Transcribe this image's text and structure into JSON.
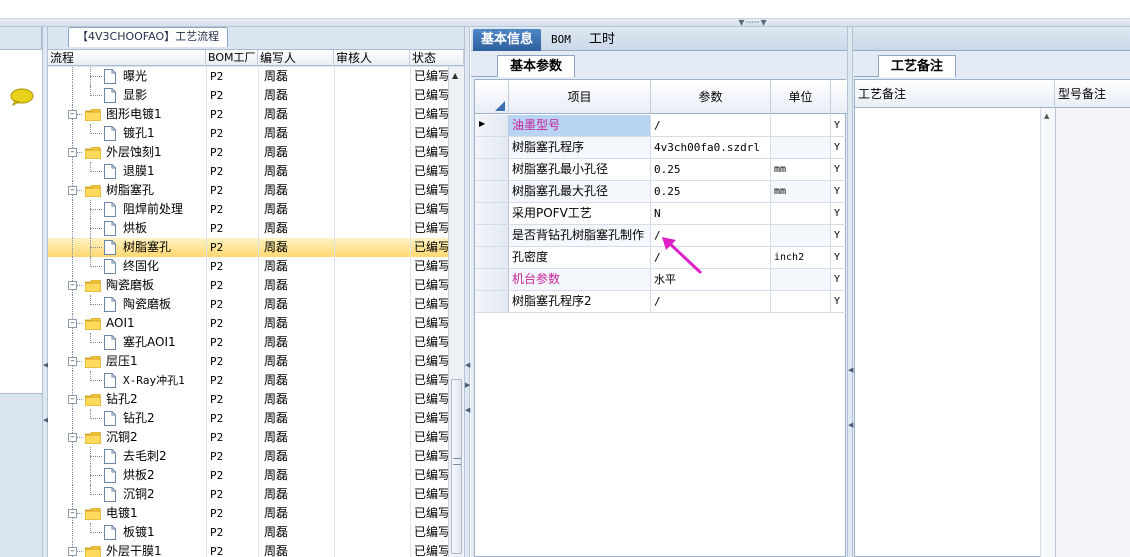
{
  "tree": {
    "title": "【4V3CHOOFAO】工艺流程",
    "columns": [
      "流程",
      "BOM工厂",
      "编写人",
      "审核人",
      "状态"
    ],
    "rows": [
      {
        "level": 2,
        "type": "doc",
        "label": "曝光",
        "bom": "P2",
        "author": "周磊",
        "reviewer": "",
        "status": "已编写",
        "last": false
      },
      {
        "level": 2,
        "type": "doc",
        "label": "显影",
        "bom": "P2",
        "author": "周磊",
        "reviewer": "",
        "status": "已编写",
        "last": true
      },
      {
        "level": 1,
        "type": "folder",
        "label": "图形电镀1",
        "bom": "P2",
        "author": "周磊",
        "reviewer": "",
        "status": "已编写"
      },
      {
        "level": 2,
        "type": "doc",
        "label": "镀孔1",
        "bom": "P2",
        "author": "周磊",
        "reviewer": "",
        "status": "已编写",
        "last": true
      },
      {
        "level": 1,
        "type": "folder",
        "label": "外层蚀刻1",
        "bom": "P2",
        "author": "周磊",
        "reviewer": "",
        "status": "已编写"
      },
      {
        "level": 2,
        "type": "doc",
        "label": "退膜1",
        "bom": "P2",
        "author": "周磊",
        "reviewer": "",
        "status": "已编写",
        "last": true
      },
      {
        "level": 1,
        "type": "folder",
        "label": "树脂塞孔",
        "bom": "P2",
        "author": "周磊",
        "reviewer": "",
        "status": "已编写"
      },
      {
        "level": 2,
        "type": "doc",
        "label": "阻焊前处理",
        "bom": "P2",
        "author": "周磊",
        "reviewer": "",
        "status": "已编写",
        "last": false
      },
      {
        "level": 2,
        "type": "doc",
        "label": "烘板",
        "bom": "P2",
        "author": "周磊",
        "reviewer": "",
        "status": "已编写",
        "last": false
      },
      {
        "level": 2,
        "type": "doc",
        "label": "树脂塞孔",
        "bom": "P2",
        "author": "周磊",
        "reviewer": "",
        "status": "已编写",
        "last": false,
        "selected": true
      },
      {
        "level": 2,
        "type": "doc",
        "label": "终固化",
        "bom": "P2",
        "author": "周磊",
        "reviewer": "",
        "status": "已编写",
        "last": true
      },
      {
        "level": 1,
        "type": "folder",
        "label": "陶瓷磨板",
        "bom": "P2",
        "author": "周磊",
        "reviewer": "",
        "status": "已编写"
      },
      {
        "level": 2,
        "type": "doc",
        "label": "陶瓷磨板",
        "bom": "P2",
        "author": "周磊",
        "reviewer": "",
        "status": "已编写",
        "last": true
      },
      {
        "level": 1,
        "type": "folder",
        "label": "AOI1",
        "bom": "P2",
        "author": "周磊",
        "reviewer": "",
        "status": "已编写"
      },
      {
        "level": 2,
        "type": "doc",
        "label": "塞孔AOI1",
        "bom": "P2",
        "author": "周磊",
        "reviewer": "",
        "status": "已编写",
        "last": true
      },
      {
        "level": 1,
        "type": "folder",
        "label": "层压1",
        "bom": "P2",
        "author": "周磊",
        "reviewer": "",
        "status": "已编写"
      },
      {
        "level": 2,
        "type": "doc",
        "label": "X-Ray冲孔1",
        "bom": "P2",
        "author": "周磊",
        "reviewer": "",
        "status": "已编写",
        "last": true
      },
      {
        "level": 1,
        "type": "folder",
        "label": "钻孔2",
        "bom": "P2",
        "author": "周磊",
        "reviewer": "",
        "status": "已编写"
      },
      {
        "level": 2,
        "type": "doc",
        "label": "钻孔2",
        "bom": "P2",
        "author": "周磊",
        "reviewer": "",
        "status": "已编写",
        "last": true
      },
      {
        "level": 1,
        "type": "folder",
        "label": "沉铜2",
        "bom": "P2",
        "author": "周磊",
        "reviewer": "",
        "status": "已编写"
      },
      {
        "level": 2,
        "type": "doc",
        "label": "去毛刺2",
        "bom": "P2",
        "author": "周磊",
        "reviewer": "",
        "status": "已编写",
        "last": false
      },
      {
        "level": 2,
        "type": "doc",
        "label": "烘板2",
        "bom": "P2",
        "author": "周磊",
        "reviewer": "",
        "status": "已编写",
        "last": false
      },
      {
        "level": 2,
        "type": "doc",
        "label": "沉铜2",
        "bom": "P2",
        "author": "周磊",
        "reviewer": "",
        "status": "已编写",
        "last": true
      },
      {
        "level": 1,
        "type": "folder",
        "label": "电镀1",
        "bom": "P2",
        "author": "周磊",
        "reviewer": "",
        "status": "已编写"
      },
      {
        "level": 2,
        "type": "doc",
        "label": "板镀1",
        "bom": "P2",
        "author": "周磊",
        "reviewer": "",
        "status": "已编写",
        "last": true
      },
      {
        "level": 1,
        "type": "folder",
        "label": "外层干膜1",
        "bom": "P2",
        "author": "周磊",
        "reviewer": "",
        "status": "已编写"
      }
    ]
  },
  "main_tabs": [
    "基本信息",
    "BOM",
    "工时"
  ],
  "params": {
    "tab": "基本参数",
    "columns": [
      "项目",
      "参数",
      "单位"
    ],
    "rows": [
      {
        "name": "油墨型号",
        "value": "/",
        "unit": "",
        "flag": "Y",
        "pink": true,
        "current": true
      },
      {
        "name": "树脂塞孔程序",
        "value": "4v3ch00fa0.szdrl",
        "unit": "",
        "flag": "Y"
      },
      {
        "name": "树脂塞孔最小孔径",
        "value": "0.25",
        "unit": "mm",
        "flag": "Y"
      },
      {
        "name": "树脂塞孔最大孔径",
        "value": "0.25",
        "unit": "mm",
        "flag": "Y"
      },
      {
        "name": "采用POFV工艺",
        "value": "N",
        "unit": "",
        "flag": "Y"
      },
      {
        "name": "是否背钻孔树脂塞孔制作",
        "value": "/",
        "unit": "",
        "flag": "Y"
      },
      {
        "name": "孔密度",
        "value": "/",
        "unit": "inch2",
        "flag": "Y"
      },
      {
        "name": "机台参数",
        "value": "水平",
        "unit": "",
        "flag": "Y",
        "pink": true
      },
      {
        "name": "树脂塞孔程序2",
        "value": "/",
        "unit": "",
        "flag": "Y"
      }
    ]
  },
  "notes": {
    "tab": "工艺备注",
    "columns": [
      "工艺备注",
      "型号备注"
    ]
  },
  "colors": {
    "accent": "#2d5f9e",
    "pink_label": "#c8229b",
    "arrow": "#e020c8",
    "selected_row": "#ffd86f"
  },
  "icons": [
    "chat-bubble-icon",
    "folder-icon",
    "document-icon",
    "expand-minus-icon",
    "pointer-arrow"
  ]
}
